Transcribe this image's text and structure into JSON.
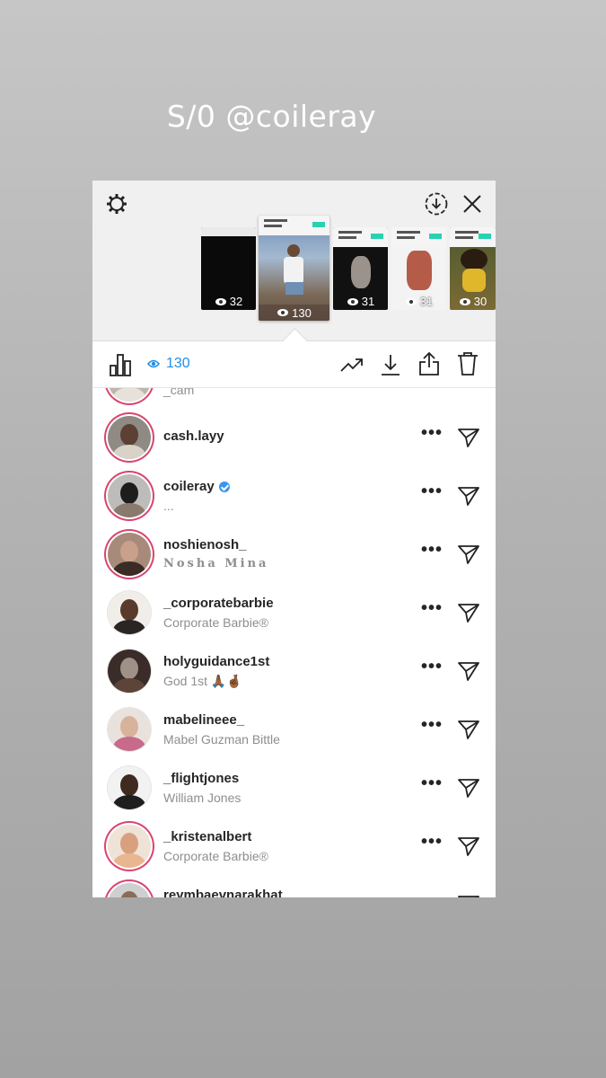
{
  "caption": "S/0 @coileray",
  "top": {
    "icons": [
      "settings-gear-icon",
      "download-circle-icon",
      "close-icon"
    ],
    "thumbnails": [
      {
        "views": "32",
        "selected": false
      },
      {
        "views": "130",
        "selected": true
      },
      {
        "views": "31",
        "selected": false
      },
      {
        "views": "31",
        "selected": false
      },
      {
        "views": "30",
        "selected": false
      }
    ]
  },
  "toolbar": {
    "view_count": "130",
    "icons": [
      "insights-bar-chart-icon",
      "eye-icon",
      "trending-icon",
      "download-icon",
      "share-icon",
      "trash-icon"
    ]
  },
  "viewers": [
    {
      "username": "",
      "subtitle": "_cam",
      "ring": true,
      "verified": false
    },
    {
      "username": "cash.layy",
      "subtitle": "",
      "ring": true,
      "verified": false
    },
    {
      "username": "coileray",
      "subtitle": "...",
      "ring": true,
      "verified": true
    },
    {
      "username": "noshienosh_",
      "subtitle": "Nosha Mina",
      "ring": true,
      "verified": false
    },
    {
      "username": "_corporatebarbie",
      "subtitle": "Corporate Barbie®",
      "ring": false,
      "verified": false
    },
    {
      "username": "holyguidance1st",
      "subtitle": "God 1st 🙏🏾🤞🏾",
      "ring": false,
      "verified": false
    },
    {
      "username": "mabelineee_",
      "subtitle": "Mabel Guzman Bittle",
      "ring": false,
      "verified": false
    },
    {
      "username": "_flightjones",
      "subtitle": "William Jones",
      "ring": false,
      "verified": false
    },
    {
      "username": "_kristenalbert",
      "subtitle": "Corporate Barbie®",
      "ring": true,
      "verified": false
    },
    {
      "username": "reymbaevnarakhat",
      "subtitle": "",
      "ring": true,
      "verified": false
    }
  ],
  "row_actions": {
    "more_label": "•••",
    "icons": [
      "more-options-icon",
      "send-message-icon"
    ]
  },
  "colors": {
    "accent": "#1f8ee8",
    "story_ring": "#d9446f",
    "verified": "#3897f0"
  }
}
